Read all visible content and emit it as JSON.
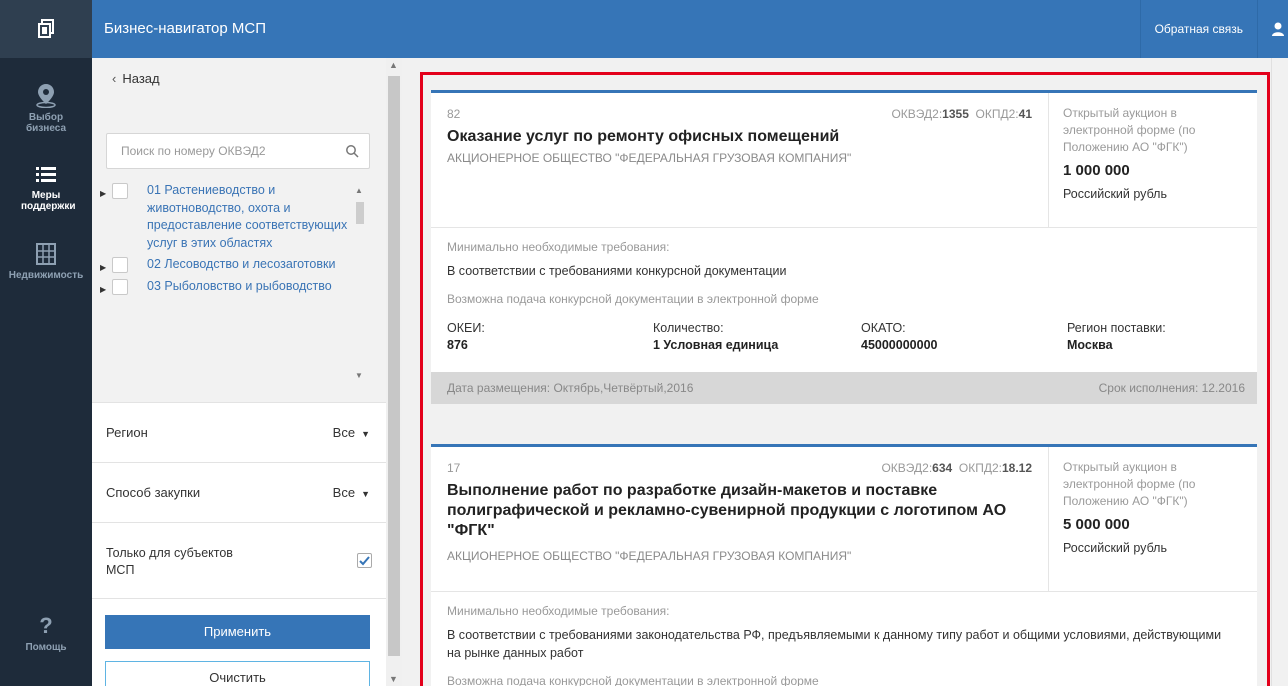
{
  "app": {
    "title": "Бизнес-навигатор МСП",
    "feedback": "Обратная связь"
  },
  "rail": {
    "items": [
      {
        "label": "Выбор бизнеса",
        "icon": "location-pin-icon"
      },
      {
        "label": "Меры поддержки",
        "icon": "list-icon"
      },
      {
        "label": "Недвижимость",
        "icon": "building-grid-icon"
      }
    ],
    "help": "Помощь"
  },
  "filters": {
    "back": "Назад",
    "search_placeholder": "Поиск по номеру ОКВЭД2",
    "tree": [
      "01 Растениеводство и животноводство, охота и предоставление соответствующих услуг в этих областях",
      "02 Лесоводство и лесозаготовки",
      "03 Рыболовство и рыбоводство"
    ],
    "region_label": "Регион",
    "region_value": "Все",
    "method_label": "Способ закупки",
    "method_value": "Все",
    "msp_label": "Только для субъектов МСП",
    "msp_checked": true,
    "apply": "Применить",
    "clear": "Очистить"
  },
  "cards": [
    {
      "num": "82",
      "okved_label": "ОКВЭД2:",
      "okved": "1355",
      "okpd_label": "ОКПД2:",
      "okpd": "41",
      "title": "Оказание услуг по ремонту офисных помещений",
      "org": "АКЦИОНЕРНОЕ ОБЩЕСТВО \"ФЕДЕРАЛЬНАЯ ГРУЗОВАЯ КОМПАНИЯ\"",
      "method": "Открытый аукцион в электронной форме (по Положению АО \"ФГК\")",
      "price": "1 000 000",
      "currency": "Российский рубль",
      "req_label": "Минимально необходимые требования:",
      "req": "В соответствии с требованиями конкурсной документации",
      "electronic": "Возможна подача конкурсной документации в электронной форме",
      "okei_label": "ОКЕИ:",
      "okei": "876",
      "qty_label": "Количество:",
      "qty": "1 Условная единица",
      "okato_label": "ОКАТО:",
      "okato": "45000000000",
      "region_label": "Регион поставки:",
      "region": "Москва",
      "posted": "Дата размещения: Октябрь,Четвёртый,2016",
      "deadline": "Срок исполнения: 12.2016"
    },
    {
      "num": "17",
      "okved_label": "ОКВЭД2:",
      "okved": "634",
      "okpd_label": "ОКПД2:",
      "okpd": "18.12",
      "title": "Выполнение работ по разработке дизайн-макетов и поставке полиграфической и рекламно-сувенирной продукции с логотипом АО \"ФГК\"",
      "org": "АКЦИОНЕРНОЕ ОБЩЕСТВО \"ФЕДЕРАЛЬНАЯ ГРУЗОВАЯ КОМПАНИЯ\"",
      "method": "Открытый аукцион в электронной форме (по Положению АО \"ФГК\")",
      "price": "5 000 000",
      "currency": "Российский рубль",
      "req_label": "Минимально необходимые требования:",
      "req": "В соответствии с требованиями законодательства РФ, предъявляемыми к данному типу работ и общими условиями, действующими на рынке данных работ",
      "electronic": "Возможна подача конкурсной документации в электронной форме"
    }
  ],
  "colors": {
    "brand": "#3675b7",
    "rail": "#1e2b3a",
    "highlight": "#e3001b"
  }
}
